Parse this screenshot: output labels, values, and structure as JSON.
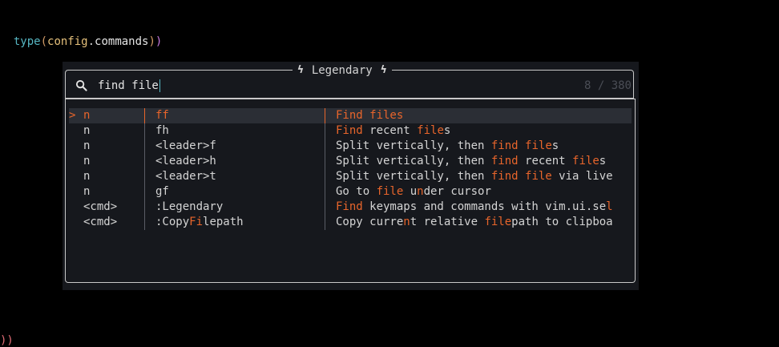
{
  "editor": {
    "line_parts": [
      "type",
      "(",
      "config",
      ".",
      "commands",
      ")",
      ")"
    ],
    "stray_text": "))"
  },
  "picker": {
    "title": "Legendary",
    "title_icon": "bolt-icon",
    "search_icon": "search-icon",
    "query": "find file",
    "counter": "8 / 380",
    "selected_marker": ">",
    "rows": [
      {
        "mode": "n",
        "key": "ff",
        "key_parts": [
          {
            "t": "ff",
            "h": true
          }
        ],
        "desc_parts": [
          {
            "t": "Find files",
            "h": true
          }
        ]
      },
      {
        "mode": "n",
        "key": "fh",
        "key_parts": [
          {
            "t": "fh",
            "h": false
          }
        ],
        "desc_parts": [
          {
            "t": "Find",
            "h": true
          },
          {
            "t": " recent ",
            "h": false
          },
          {
            "t": "file",
            "h": true
          },
          {
            "t": "s",
            "h": false
          }
        ]
      },
      {
        "mode": "n",
        "key": "<leader>f",
        "key_parts": [
          {
            "t": "<leader>f",
            "h": false
          }
        ],
        "desc_parts": [
          {
            "t": "Split vertically, then ",
            "h": false
          },
          {
            "t": "find",
            "h": true
          },
          {
            "t": " ",
            "h": false
          },
          {
            "t": "file",
            "h": true
          },
          {
            "t": "s",
            "h": false
          }
        ]
      },
      {
        "mode": "n",
        "key": "<leader>h",
        "key_parts": [
          {
            "t": "<leader>h",
            "h": false
          }
        ],
        "desc_parts": [
          {
            "t": "Split vertically, then ",
            "h": false
          },
          {
            "t": "find",
            "h": true
          },
          {
            "t": " recent ",
            "h": false
          },
          {
            "t": "file",
            "h": true
          },
          {
            "t": "s",
            "h": false
          }
        ]
      },
      {
        "mode": "n",
        "key": "<leader>t",
        "key_parts": [
          {
            "t": "<leader>t",
            "h": false
          }
        ],
        "desc_parts": [
          {
            "t": "Split vertically, then ",
            "h": false
          },
          {
            "t": "find file",
            "h": true
          },
          {
            "t": " via live",
            "h": false
          }
        ]
      },
      {
        "mode": "n",
        "key": "gf",
        "key_parts": [
          {
            "t": "gf",
            "h": false
          }
        ],
        "desc_parts": [
          {
            "t": "Go to ",
            "h": false
          },
          {
            "t": "file",
            "h": true
          },
          {
            "t": " ",
            "h": false
          },
          {
            "t": "u",
            "h": false
          },
          {
            "t": "n",
            "h": true
          },
          {
            "t": "der cursor",
            "h": false
          }
        ]
      },
      {
        "mode": "<cmd>",
        "key": ":Legendary",
        "key_parts": [
          {
            "t": ":Legendary",
            "h": false
          }
        ],
        "desc_parts": [
          {
            "t": "Find",
            "h": true
          },
          {
            "t": " keymaps and commands with vim.ui.se",
            "h": false
          },
          {
            "t": "l",
            "h": true
          }
        ]
      },
      {
        "mode": "<cmd>",
        "key": ":CopyFilepath",
        "key_parts": [
          {
            "t": ":Copy",
            "h": false
          },
          {
            "t": "Fi",
            "h": true
          },
          {
            "t": "lepath",
            "h": false
          }
        ],
        "desc_parts": [
          {
            "t": "Copy curre",
            "h": false
          },
          {
            "t": "n",
            "h": true
          },
          {
            "t": "t relative ",
            "h": false
          },
          {
            "t": "file",
            "h": true
          },
          {
            "t": "path to clipboa",
            "h": false
          }
        ]
      }
    ]
  },
  "colors": {
    "highlight": "#e8652b",
    "border": "#c8c8c8",
    "background": "#16181d",
    "selected_row": "#2b2e35"
  }
}
